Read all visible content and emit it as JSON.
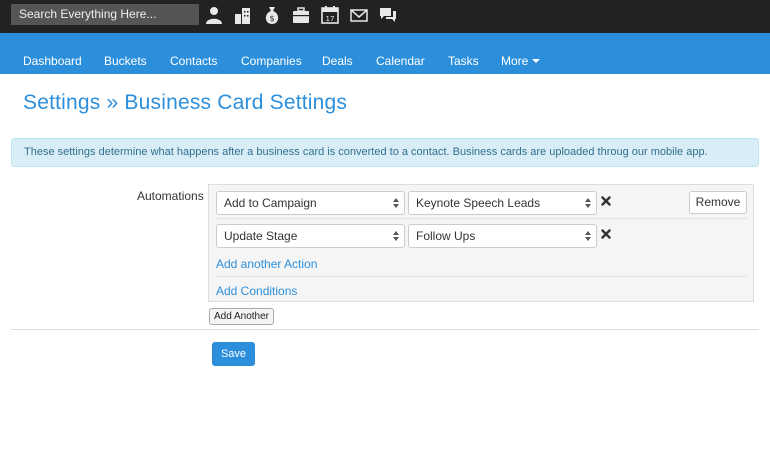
{
  "topbar": {
    "search_placeholder": "Search Everything Here...",
    "icons": [
      "user-icon",
      "buildings-icon",
      "money-bag-icon",
      "briefcase-icon",
      "calendar-icon",
      "envelope-icon",
      "chat-icon"
    ],
    "calendar_day": "17"
  },
  "nav": {
    "items": [
      "Dashboard",
      "Buckets",
      "Contacts",
      "Companies",
      "Deals",
      "Calendar",
      "Tasks"
    ],
    "more_label": "More"
  },
  "page": {
    "title": "Settings » Business Card Settings",
    "info": "These settings determine what happens after a business card is converted to a contact. Business cards are uploaded throug our mobile app."
  },
  "automations": {
    "label": "Automations",
    "rows": [
      {
        "action": "Add to Campaign",
        "value": "Keynote Speech Leads"
      },
      {
        "action": "Update Stage",
        "value": "Follow Ups"
      }
    ],
    "remove_label": "Remove",
    "add_action_label": "Add another Action",
    "add_conditions_label": "Add Conditions",
    "add_another_label": "Add Another"
  },
  "save_label": "Save",
  "colors": {
    "topbar": "#222222",
    "nav": "#2c8fdc",
    "accent": "#2c8fdc",
    "info_bg": "#d9edf7",
    "info_text": "#31708f"
  }
}
